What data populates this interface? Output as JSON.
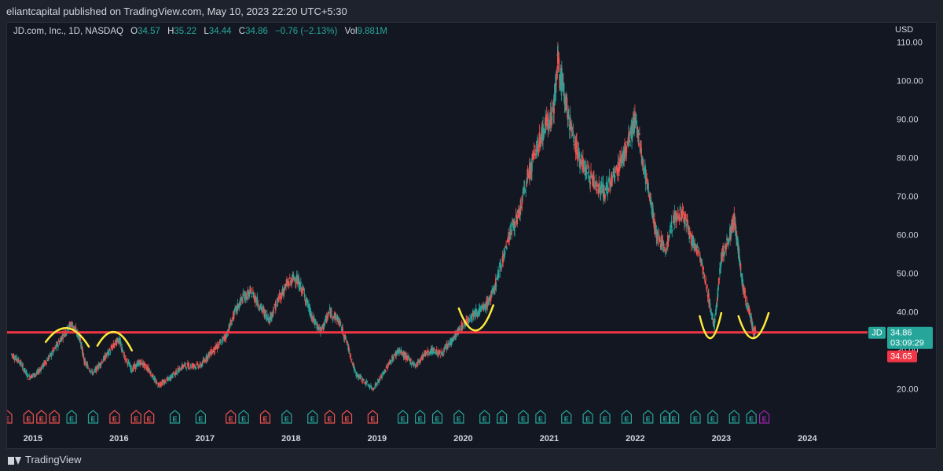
{
  "header": {
    "published_text": "eliantcapital published on TradingView.com, May 10, 2023 22:20 UTC+5:30"
  },
  "legend": {
    "symbol": "JD.com, Inc., 1D, NASDAQ",
    "o_label": "O",
    "o_value": "34.57",
    "h_label": "H",
    "h_value": "35.22",
    "l_label": "L",
    "l_value": "34.44",
    "c_label": "C",
    "c_value": "34.86",
    "change": "−0.76 (−2.13%)",
    "vol_label": "Vol",
    "vol_value": "9.881M"
  },
  "footer": {
    "brand": "TradingView"
  },
  "colors": {
    "up": "#26a69a",
    "down": "#ef5350",
    "support": "#f23645",
    "annotation": "#ffeb3b",
    "earnings_purple": "#9c27b0"
  },
  "chart_data": {
    "type": "line",
    "title": "JD.com, Inc., 1D, NASDAQ",
    "ylabel": "USD",
    "ylim": [
      15,
      115
    ],
    "xlim": [
      2014.7,
      2024.7
    ],
    "y_ticks": [
      "20.00",
      "30.00",
      "40.00",
      "50.00",
      "60.00",
      "70.00",
      "80.00",
      "90.00",
      "100.00",
      "110.00"
    ],
    "x_ticks": [
      "2015",
      "2016",
      "2017",
      "2018",
      "2019",
      "2020",
      "2021",
      "2022",
      "2023",
      "2024"
    ],
    "series": [
      {
        "points": [
          [
            2014.75,
            29
          ],
          [
            2014.85,
            27
          ],
          [
            2014.95,
            23
          ],
          [
            2015.05,
            24
          ],
          [
            2015.15,
            27
          ],
          [
            2015.25,
            30
          ],
          [
            2015.35,
            34
          ],
          [
            2015.45,
            37
          ],
          [
            2015.55,
            33
          ],
          [
            2015.6,
            27
          ],
          [
            2015.7,
            24
          ],
          [
            2015.8,
            27
          ],
          [
            2015.9,
            30
          ],
          [
            2016.0,
            33
          ],
          [
            2016.05,
            29
          ],
          [
            2016.15,
            25
          ],
          [
            2016.25,
            27
          ],
          [
            2016.35,
            25
          ],
          [
            2016.45,
            21
          ],
          [
            2016.55,
            22
          ],
          [
            2016.65,
            24
          ],
          [
            2016.75,
            26
          ],
          [
            2016.85,
            26
          ],
          [
            2016.95,
            26
          ],
          [
            2017.05,
            29
          ],
          [
            2017.15,
            31
          ],
          [
            2017.25,
            34
          ],
          [
            2017.35,
            40
          ],
          [
            2017.45,
            44
          ],
          [
            2017.55,
            45
          ],
          [
            2017.65,
            41
          ],
          [
            2017.75,
            38
          ],
          [
            2017.85,
            43
          ],
          [
            2017.95,
            47
          ],
          [
            2018.05,
            49
          ],
          [
            2018.15,
            45
          ],
          [
            2018.25,
            38
          ],
          [
            2018.35,
            35
          ],
          [
            2018.45,
            40
          ],
          [
            2018.55,
            38
          ],
          [
            2018.65,
            32
          ],
          [
            2018.75,
            24
          ],
          [
            2018.85,
            22
          ],
          [
            2018.95,
            20
          ],
          [
            2019.05,
            23
          ],
          [
            2019.15,
            27
          ],
          [
            2019.25,
            30
          ],
          [
            2019.35,
            28
          ],
          [
            2019.45,
            26
          ],
          [
            2019.55,
            29
          ],
          [
            2019.65,
            30
          ],
          [
            2019.75,
            29
          ],
          [
            2019.85,
            32
          ],
          [
            2019.95,
            35
          ],
          [
            2020.05,
            38
          ],
          [
            2020.15,
            40
          ],
          [
            2020.25,
            41
          ],
          [
            2020.35,
            45
          ],
          [
            2020.45,
            53
          ],
          [
            2020.55,
            61
          ],
          [
            2020.65,
            65
          ],
          [
            2020.75,
            75
          ],
          [
            2020.85,
            82
          ],
          [
            2020.95,
            88
          ],
          [
            2021.05,
            92
          ],
          [
            2021.1,
            105
          ],
          [
            2021.15,
            100
          ],
          [
            2021.25,
            88
          ],
          [
            2021.35,
            80
          ],
          [
            2021.45,
            76
          ],
          [
            2021.55,
            73
          ],
          [
            2021.65,
            71
          ],
          [
            2021.75,
            75
          ],
          [
            2021.85,
            80
          ],
          [
            2021.95,
            86
          ],
          [
            2022.0,
            90
          ],
          [
            2022.1,
            78
          ],
          [
            2022.2,
            66
          ],
          [
            2022.25,
            60
          ],
          [
            2022.35,
            56
          ],
          [
            2022.45,
            64
          ],
          [
            2022.55,
            66
          ],
          [
            2022.65,
            59
          ],
          [
            2022.75,
            55
          ],
          [
            2022.85,
            44
          ],
          [
            2022.92,
            36
          ],
          [
            2023.0,
            54
          ],
          [
            2023.1,
            60
          ],
          [
            2023.15,
            64
          ],
          [
            2023.2,
            56
          ],
          [
            2023.25,
            47
          ],
          [
            2023.3,
            42
          ],
          [
            2023.35,
            38
          ],
          [
            2023.37,
            35
          ],
          [
            2023.4,
            34.9
          ]
        ]
      }
    ],
    "support_level": 34.65,
    "events": [
      "E",
      "E",
      "E",
      "E",
      "E",
      "E",
      "E",
      "E",
      "E",
      "E",
      "E",
      "E",
      "E",
      "E",
      "E",
      "E",
      "E",
      "E",
      "E",
      "E",
      "E",
      "E",
      "E",
      "E",
      "E",
      "E",
      "E",
      "E",
      "E",
      "E",
      "E",
      "E",
      "E",
      "E",
      "E",
      "E",
      "E",
      "E",
      "E",
      "E",
      "E",
      "E"
    ],
    "event_x": [
      2014.7,
      2014.95,
      2015.1,
      2015.25,
      2015.45,
      2015.7,
      2015.95,
      2016.2,
      2016.35,
      2016.65,
      2016.95,
      2017.3,
      2017.45,
      2017.7,
      2017.95,
      2018.25,
      2018.45,
      2018.65,
      2018.95,
      2019.3,
      2019.5,
      2019.7,
      2019.95,
      2020.25,
      2020.45,
      2020.7,
      2020.9,
      2021.2,
      2021.45,
      2021.65,
      2021.9,
      2022.15,
      2022.35,
      2022.45,
      2022.7,
      2022.9,
      2023.15,
      2023.35,
      2023.5
    ],
    "event_kind": [
      "down",
      "down",
      "down",
      "down",
      "up",
      "up",
      "down",
      "down",
      "down",
      "up",
      "up",
      "down",
      "up",
      "down",
      "up",
      "up",
      "down",
      "down",
      "down",
      "up",
      "up",
      "up",
      "up",
      "up",
      "up",
      "up",
      "up",
      "up",
      "up",
      "up",
      "up",
      "up",
      "up",
      "up",
      "up",
      "up",
      "up",
      "up",
      "future"
    ],
    "price_tags": {
      "symbol": "JD",
      "last": "34.86",
      "countdown": "03:09:29",
      "level": "34.65"
    },
    "annotations": [
      {
        "kind": "arch",
        "x": [
          2015.15,
          2015.65
        ],
        "y": 33
      },
      {
        "kind": "arch",
        "x": [
          2015.75,
          2016.15
        ],
        "y": 32
      },
      {
        "kind": "cup",
        "x": [
          2019.95,
          2020.35
        ],
        "y": 38
      },
      {
        "kind": "cup",
        "x": [
          2022.75,
          2023.0
        ],
        "y": 36
      },
      {
        "kind": "cup",
        "x": [
          2023.2,
          2023.55
        ],
        "y": 36
      }
    ]
  }
}
